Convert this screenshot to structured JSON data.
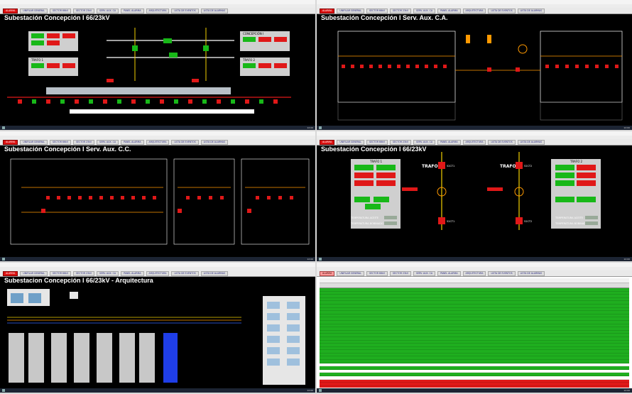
{
  "windows": [
    {
      "id": "w1",
      "title": "Subestación Concepción I 66/23kV"
    },
    {
      "id": "w2",
      "title": "Subestación Concepción I Serv. Aux. C.A."
    },
    {
      "id": "w3",
      "title": "Subestación Concepción I Serv. Aux. C.C."
    },
    {
      "id": "w4",
      "title": "Subestación Concepción I 66/23kV"
    },
    {
      "id": "w5",
      "title": "Subestacion Concepción I 66/23kV - Arquitectura"
    },
    {
      "id": "w6",
      "title": ""
    }
  ],
  "nav": {
    "alarm_label": "ALARMA",
    "items": [
      "UNIFILAR GENERAL",
      "SECTOR 66kV",
      "SECTOR 23kV",
      "SERV. AUX. CA",
      "PANEL ALARMA",
      "ARQUITECTURA",
      "LISTA DE EVENTOS",
      "LISTA DE ALARMAS"
    ]
  },
  "labels": {
    "w1_trafo1": "TRAFO 1",
    "w1_trafo2": "TRAFO 2",
    "w1_concepcion": "CONCEPCIÓN I",
    "w4_trafo1_title": "TRAFO 1",
    "w4_trafo2_title": "TRAFO 2",
    "w4_trafo1_big": "TRAFO 1",
    "w4_trafo2_big": "TRAFO 2",
    "w4_52ct1": "52CT1",
    "w4_52ct2": "52CT2",
    "w4_52ct1b": "52CT1",
    "w4_52ct2b": "52CT2",
    "w4_temp_aceite": "TEMPERATURA ACEITE",
    "w4_temp_bobinado": "TEMPERATURA BOBINADO",
    "w4_temp_aceite2": "TEMPERATURA ACEITE",
    "w4_temp_bobinado2": "TEMPERATURA BOBINADO"
  },
  "taskbar": {
    "clock": "12:00"
  },
  "colors": {
    "green": "#18b818",
    "red": "#e01818",
    "orange": "#ff9900",
    "yellow": "#f2d000",
    "grey": "#c8c8c8"
  }
}
